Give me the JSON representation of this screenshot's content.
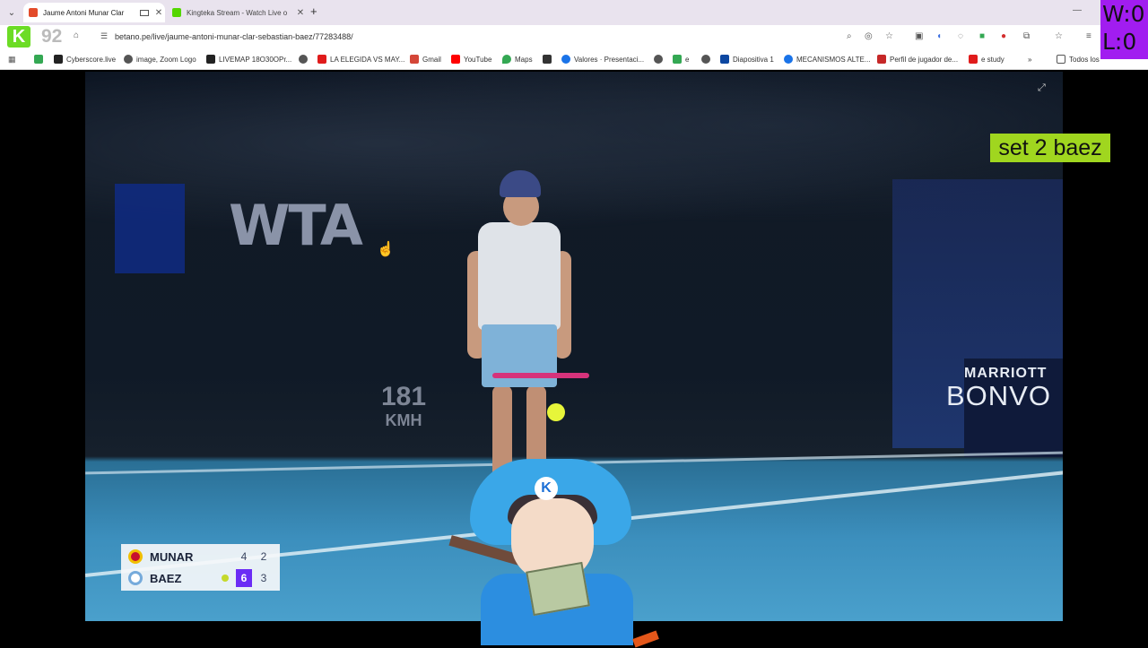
{
  "browser": {
    "tabs": [
      {
        "title": "Jaume Antoni Munar Clar",
        "active": true,
        "favicon_color": "#e34b2a"
      },
      {
        "title": "Kingteka Stream - Watch Live o",
        "active": false,
        "favicon_color": "#53d600"
      }
    ],
    "url": "betano.pe/live/jaume-antoni-munar-clar-sebastian-baez/77283488/",
    "bookmarks": [
      {
        "label": "Cyberscore.live",
        "color": "#222"
      },
      {
        "label": "image, Zoom Logo",
        "color": "#555"
      },
      {
        "label": "LIVEMAP 18O30OPr...",
        "color": "#222"
      },
      {
        "label": "",
        "color": "#555"
      },
      {
        "label": "LA ELEGIDA VS MAY...",
        "color": "#e01b1b"
      },
      {
        "label": "Gmail",
        "color": "#d44638"
      },
      {
        "label": "YouTube",
        "color": "#ff0000"
      },
      {
        "label": "Maps",
        "color": "#34a853"
      },
      {
        "label": "",
        "color": "#333"
      },
      {
        "label": "Valores · Presentaci...",
        "color": "#1a73e8"
      },
      {
        "label": "",
        "color": "#555"
      },
      {
        "label": "e",
        "color": "#34a853"
      },
      {
        "label": "",
        "color": "#555"
      },
      {
        "label": "Diapositiva 1",
        "color": "#0d47a1"
      },
      {
        "label": "MECANISMOS ALTE...",
        "color": "#1a73e8"
      },
      {
        "label": "Perfil de jugador de...",
        "color": "#c62828"
      },
      {
        "label": "e study",
        "color": "#e01b1b"
      }
    ],
    "bookmarks_more": "»",
    "all_bookmarks": "Todos los"
  },
  "overlay": {
    "k_count": "92",
    "wins": "W:0",
    "losses": "L:0",
    "note": "set 2 baez",
    "avatar_hat_letter": "K"
  },
  "video": {
    "banner_left": "WTA",
    "banner_right_top": "MARRIOTT",
    "banner_right_bottom": "BONVO",
    "speed_value": "181",
    "speed_unit": "KMH"
  },
  "scoreboard": {
    "players": [
      {
        "name": "MUNAR",
        "flag_color": "#c8102e",
        "serving": false,
        "sets": [
          "4",
          "2"
        ],
        "set1_won": false
      },
      {
        "name": "BAEZ",
        "flag_color": "#75aadb",
        "serving": true,
        "sets": [
          "6",
          "3"
        ],
        "set1_won": true
      }
    ]
  }
}
